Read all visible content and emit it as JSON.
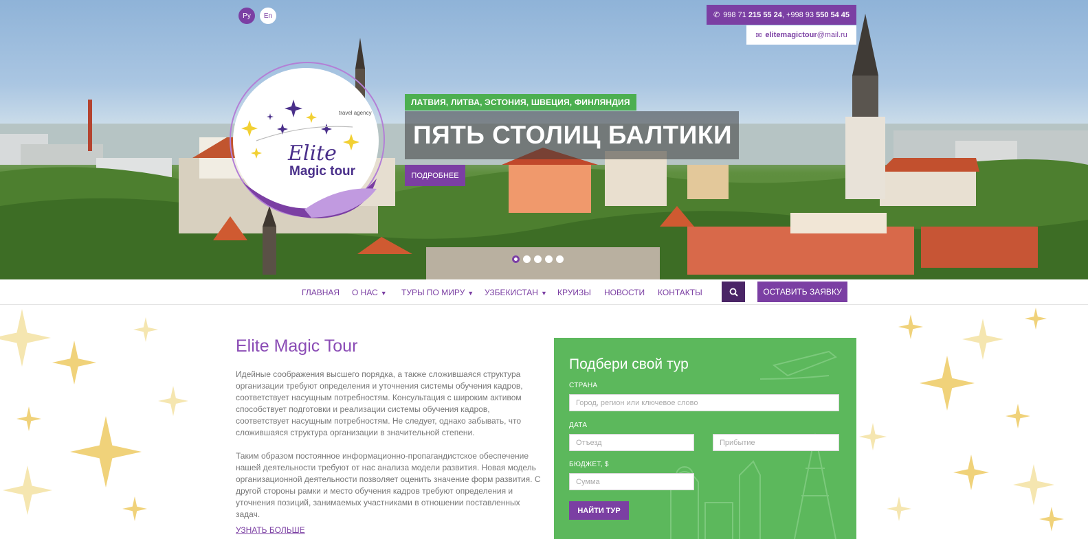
{
  "colors": {
    "brand": "#7b3fa3",
    "accent_green": "#5cb85c",
    "dark_purple": "#4a2566"
  },
  "header": {
    "lang_ru": "Ру",
    "lang_en": "En",
    "phone_prefix1": "998 71",
    "phone_num1": "215 55 24",
    "phone_prefix2": ", +998 93",
    "phone_num2": "550 54 45",
    "email_name": "elitemagictour",
    "email_domain": "@mail.ru"
  },
  "logo": {
    "tagline": "travel agency",
    "line1": "Elite",
    "line2": "Magic tour"
  },
  "slider": {
    "countries": "ЛАТВИЯ, ЛИТВА, ЭСТОНИЯ, ШВЕЦИЯ, ФИНЛЯНДИЯ",
    "title": "ПЯТЬ СТОЛИЦ БАЛТИКИ",
    "more_label": "ПОДРОБНЕЕ",
    "slide_count": 5,
    "active_slide": 1
  },
  "nav": {
    "items": [
      {
        "label": "ГЛАВНАЯ",
        "dropdown": false
      },
      {
        "label": "О НАС",
        "dropdown": true
      },
      {
        "label": "ТУРЫ ПО МИРУ",
        "dropdown": true
      },
      {
        "label": "УЗБЕКИСТАН",
        "dropdown": true
      },
      {
        "label": "КРУИЗЫ",
        "dropdown": false
      },
      {
        "label": "НОВОСТИ",
        "dropdown": false
      },
      {
        "label": "КОНТАКТЫ",
        "dropdown": false
      }
    ],
    "search_icon": "search-icon",
    "order_label": "ОСТАВИТЬ ЗАЯВКУ"
  },
  "about": {
    "title": "Elite Magic Tour",
    "p1": "Идейные соображения высшего порядка, а также сложившаяся структура организации требуют определения и уточнения системы обучения кадров, соответствует насущным потребностям. Консультация с широким активом способствует подготовки и реализации системы обучения кадров, соответствует насущным потребностям. Не следует, однако забывать, что сложившаяся структура организации в значительной степени.",
    "p2": "Таким образом постоянное информационно-пропагандистское обеспечение нашей деятельности требуют от нас анализа модели развития. Новая модель организационной деятельности позволяет оценить значение форм развития. С другой стороны рамки и место обучения кадров требуют определения и уточнения позиций, занимаемых участниками в отношении поставленных задач.",
    "learn_more": "УЗНАТЬ БОЛЬШЕ"
  },
  "tour_form": {
    "title": "Подбери свой тур",
    "country_label": "СТРАНА",
    "country_placeholder": "Город, регион или ключевое слово",
    "date_label": "ДАТА",
    "depart_placeholder": "Отъезд",
    "arrive_placeholder": "Прибытие",
    "budget_label": "БЮДЖЕТ, $",
    "budget_placeholder": "Сумма",
    "submit_label": "НАЙТИ ТУР"
  }
}
